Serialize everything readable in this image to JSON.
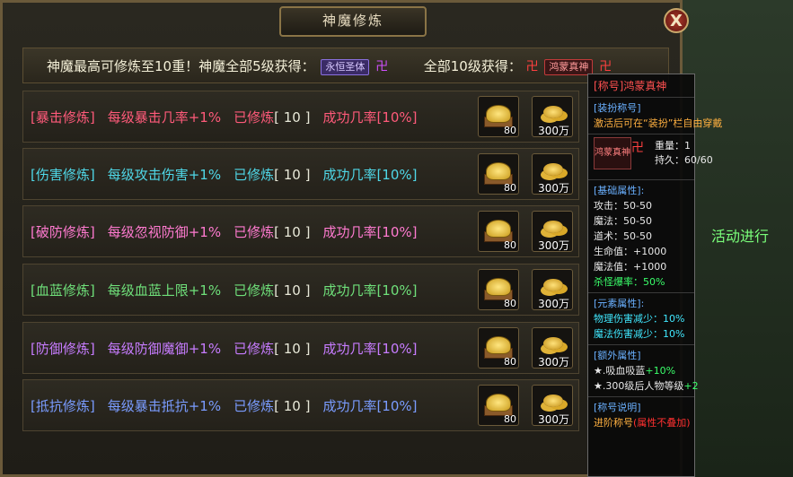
{
  "window": {
    "title": "神魔修炼",
    "close_glyph": "X"
  },
  "banner": {
    "part1": "神魔最高可修炼至10重！神魔全部5级获得：",
    "badge1": "永恒圣体",
    "part2": "全部10级获得：",
    "badge2": "鸿蒙真神",
    "swastika": "卍"
  },
  "rows": [
    {
      "name": "[暴击修炼]",
      "desc": "每级暴击几率+1%",
      "done_label": "已修炼",
      "level": "[ 10 ]",
      "rate_label": "成功几率[10%]",
      "cost_item": "80",
      "cost_gold": "300万",
      "color": "#ff5a7a"
    },
    {
      "name": "[伤害修炼]",
      "desc": "每级攻击伤害+1%",
      "done_label": "已修炼",
      "level": "[ 10 ]",
      "rate_label": "成功几率[10%]",
      "cost_item": "80",
      "cost_gold": "300万",
      "color": "#4fd8e8"
    },
    {
      "name": "[破防修炼]",
      "desc": "每级忽视防御+1%",
      "done_label": "已修炼",
      "level": "[ 10 ]",
      "rate_label": "成功几率[10%]",
      "cost_item": "80",
      "cost_gold": "300万",
      "color": "#ff7ad0"
    },
    {
      "name": "[血蓝修炼]",
      "desc": "每级血蓝上限+1%",
      "done_label": "已修炼",
      "level": "[ 10 ]",
      "rate_label": "成功几率[10%]",
      "cost_item": "80",
      "cost_gold": "300万",
      "color": "#6fe07a"
    },
    {
      "name": "[防御修炼]",
      "desc": "每级防御魔御+1%",
      "done_label": "已修炼",
      "level": "[ 10 ]",
      "rate_label": "成功几率[10%]",
      "cost_item": "80",
      "cost_gold": "300万",
      "color": "#c77cff"
    },
    {
      "name": "[抵抗修炼]",
      "desc": "每级暴击抵抗+1%",
      "done_label": "已修炼",
      "level": "[ 10 ]",
      "rate_label": "成功几率[10%]",
      "cost_item": "80",
      "cost_gold": "300万",
      "color": "#7a9cff"
    }
  ],
  "tooltip": {
    "title": "[称号]鸿蒙真神",
    "dress_label": "[装扮称号]",
    "dress_desc": "激活后可在“装扮”栏自由穿戴",
    "icon_text": "鸿蒙真神",
    "icon_glyph": "卍",
    "weight": "重量：1",
    "durability": "持久：60/60",
    "base_label": "[基础属性]:",
    "base": [
      "攻击：50-50",
      "魔法：50-50",
      "道术：50-50",
      "生命值：+1000",
      "魔法值：+1000"
    ],
    "kill_rate": "杀怪爆率：50%",
    "elem_label": "[元素属性]:",
    "elem": [
      "物理伤害减少：10%",
      "魔法伤害减少：10%"
    ],
    "extra_label": "[额外属性]",
    "extra1_prefix": "★.吸血吸蓝",
    "extra1_val": "+10%",
    "extra2_prefix": "★.300级后人物等级",
    "extra2_val": "+2",
    "desc_label": "[称号说明]",
    "desc_prefix": "进阶称号",
    "desc_red": "(属性不叠加)"
  },
  "background": {
    "side_text": "活动进行"
  }
}
